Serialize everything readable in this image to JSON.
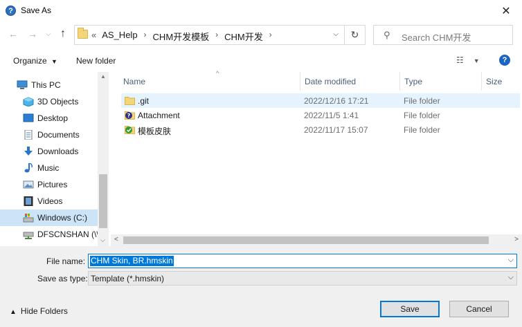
{
  "window": {
    "title": "Save As",
    "close": "✕"
  },
  "nav": {
    "breadcrumbs": [
      "AS_Help",
      "CHM开发模板",
      "CHM开发"
    ],
    "overflow": "«",
    "search_placeholder": "Search CHM开发"
  },
  "toolbar": {
    "organize": "Organize",
    "new_folder": "New folder",
    "help": "?"
  },
  "sidebar": {
    "items": [
      {
        "label": "This PC",
        "icon": "computer-icon"
      },
      {
        "label": "3D Objects",
        "icon": "cube-icon"
      },
      {
        "label": "Desktop",
        "icon": "desktop-icon"
      },
      {
        "label": "Documents",
        "icon": "documents-icon"
      },
      {
        "label": "Downloads",
        "icon": "download-icon"
      },
      {
        "label": "Music",
        "icon": "music-icon"
      },
      {
        "label": "Pictures",
        "icon": "pictures-icon"
      },
      {
        "label": "Videos",
        "icon": "videos-icon"
      },
      {
        "label": "Windows (C:)",
        "icon": "drive-icon"
      },
      {
        "label": "DFSCNSHAN (\\\\",
        "icon": "network-drive-icon"
      }
    ]
  },
  "columns": {
    "name": "Name",
    "date": "Date modified",
    "type": "Type",
    "size": "Size"
  },
  "files": [
    {
      "name": ".git",
      "date": "2022/12/16 17:21",
      "type": "File folder",
      "icon": "folder-icon"
    },
    {
      "name": "Attachment",
      "date": "2022/11/5 1:41",
      "type": "File folder",
      "icon": "help-folder-icon"
    },
    {
      "name": "模板皮肤",
      "date": "2022/11/17 15:07",
      "type": "File folder",
      "icon": "checked-folder-icon"
    }
  ],
  "form": {
    "filename_label": "File name:",
    "filename_value": "CHM Skin, BR.hmskin",
    "savetype_label": "Save as type:",
    "savetype_value": "Template (*.hmskin)"
  },
  "footer": {
    "hide_folders": "Hide Folders",
    "save": "Save",
    "cancel": "Cancel"
  },
  "colors": {
    "accent": "#0078d7",
    "selection": "#cce4f7",
    "folder": "#f4d57a"
  }
}
